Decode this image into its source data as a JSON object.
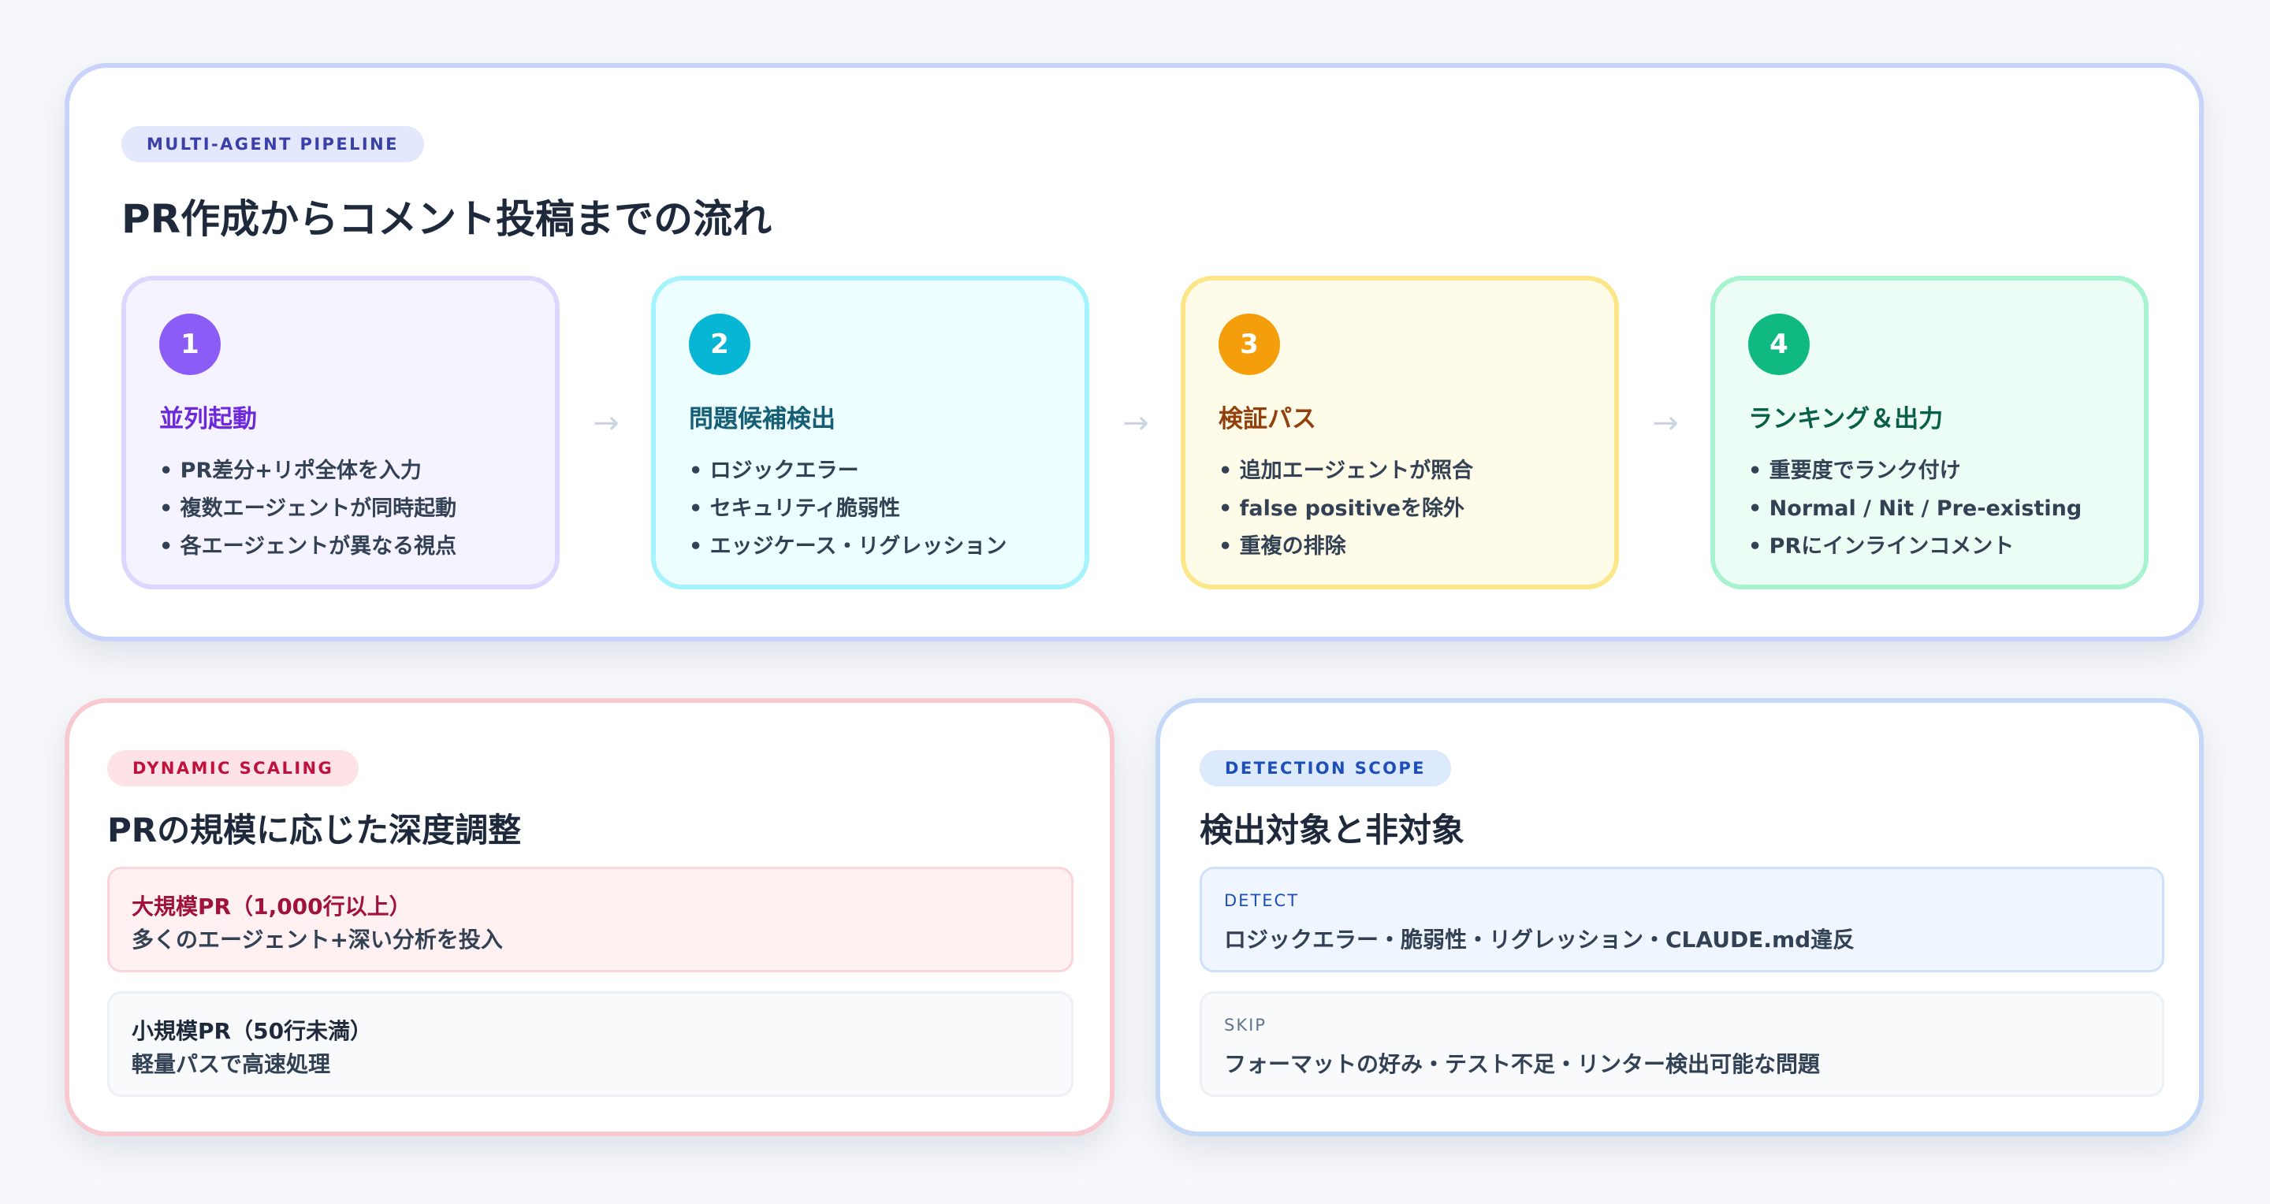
{
  "pipeline": {
    "badge": "MULTI-AGENT PIPELINE",
    "title": "PR作成からコメント投稿までの流れ",
    "arrow": "→",
    "steps": [
      {
        "number": "1",
        "title": "並列起動",
        "color": "#8b5cf6",
        "title_color": "#6d28d9",
        "items": [
          "PR差分+リポ全体を入力",
          "複数エージェントが同時起動",
          "各エージェントが異なる視点"
        ]
      },
      {
        "number": "2",
        "title": "問題候補検出",
        "color": "#06b6d4",
        "title_color": "#155e75",
        "items": [
          "ロジックエラー",
          "セキュリティ脆弱性",
          "エッジケース・リグレッション"
        ]
      },
      {
        "number": "3",
        "title": "検証パス",
        "color": "#f59e0b",
        "title_color": "#92400e",
        "items": [
          "追加エージェントが照合",
          "false positiveを除外",
          "重複の排除"
        ]
      },
      {
        "number": "4",
        "title": "ランキング＆出力",
        "color": "#10b981",
        "title_color": "#065f46",
        "items": [
          "重要度でランク付け",
          "Normal / Nit / Pre-existing",
          "PRにインラインコメント"
        ]
      }
    ]
  },
  "scaling": {
    "badge": "DYNAMIC SCALING",
    "title": "PRの規模に応じた深度調整",
    "large": {
      "title": "大規模PR（1,000行以上）",
      "desc": "多くのエージェント+深い分析を投入"
    },
    "small": {
      "title": "小規模PR（50行未満）",
      "desc": "軽量パスで高速処理"
    }
  },
  "scope": {
    "badge": "DETECTION SCOPE",
    "title": "検出対象と非対象",
    "detect": {
      "label": "DETECT",
      "text": "ロジックエラー・脆弱性・リグレッション・CLAUDE.md違反"
    },
    "skip": {
      "label": "SKIP",
      "text": "フォーマットの好み・テスト不足・リンター検出可能な問題"
    }
  }
}
